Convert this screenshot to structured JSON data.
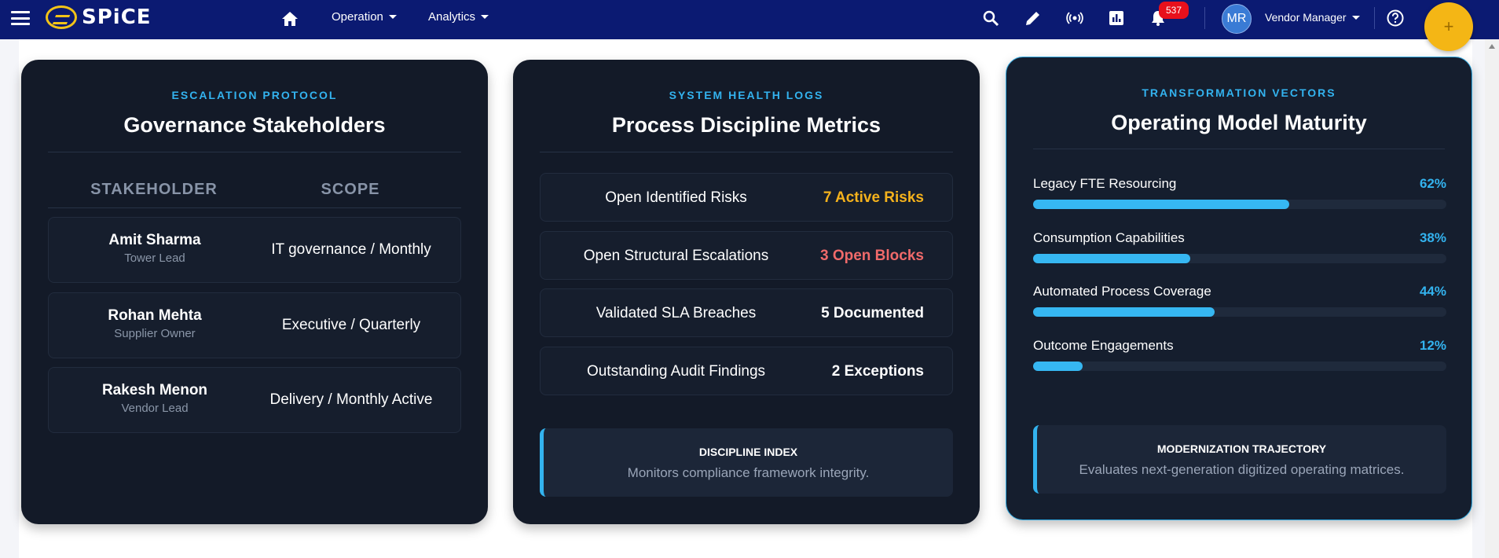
{
  "app": {
    "logo_text": "SPiCE",
    "nav": [
      {
        "label": "Operation"
      },
      {
        "label": "Analytics"
      }
    ],
    "notification_count": "537",
    "user_initials": "MR",
    "user_role": "Vendor Manager",
    "fab_symbol": "+",
    "colors": {
      "topbar": "#0b1a72",
      "accent": "#33b3ef",
      "fab": "#f4b615",
      "badge": "#e8101c"
    }
  },
  "icons": [
    "menu-icon",
    "home-icon",
    "search-icon",
    "pencil-icon",
    "broadcast-icon",
    "report-icon",
    "bell-icon",
    "help-icon"
  ],
  "cards": {
    "stakeholders": {
      "eyebrow": "ESCALATION PROTOCOL",
      "title": "Governance Stakeholders",
      "columns": [
        "STAKEHOLDER",
        "SCOPE"
      ],
      "rows": [
        {
          "name": "Amit Sharma",
          "role": "Tower Lead",
          "scope": "IT governance / Monthly"
        },
        {
          "name": "Rohan Mehta",
          "role": "Supplier Owner",
          "scope": "Executive / Quarterly"
        },
        {
          "name": "Rakesh Menon",
          "role": "Vendor Lead",
          "scope": "Delivery / Monthly Active"
        }
      ]
    },
    "metrics": {
      "eyebrow": "SYSTEM HEALTH LOGS",
      "title": "Process Discipline Metrics",
      "rows": [
        {
          "label": "Open Identified Risks",
          "value": "7 Active Risks",
          "color": "#f5b21c"
        },
        {
          "label": "Open Structural Escalations",
          "value": "3 Open Blocks",
          "color": "#f06a6a"
        },
        {
          "label": "Validated SLA Breaches",
          "value": "5 Documented",
          "color": "#ffffff"
        },
        {
          "label": "Outstanding Audit Findings",
          "value": "2 Exceptions",
          "color": "#ffffff"
        }
      ],
      "info_title": "DISCIPLINE INDEX",
      "info_text": "Monitors compliance framework integrity."
    },
    "maturity": {
      "eyebrow": "TRANSFORMATION VECTORS",
      "title": "Operating Model Maturity",
      "items": [
        {
          "label": "Legacy FTE Resourcing",
          "percent": "62%",
          "value": 62
        },
        {
          "label": "Consumption Capabilities",
          "percent": "38%",
          "value": 38
        },
        {
          "label": "Automated Process Coverage",
          "percent": "44%",
          "value": 44
        },
        {
          "label": "Outcome Engagements",
          "percent": "12%",
          "value": 12
        }
      ],
      "info_title": "MODERNIZATION TRAJECTORY",
      "info_text": "Evaluates next-generation digitized operating matrices."
    }
  }
}
